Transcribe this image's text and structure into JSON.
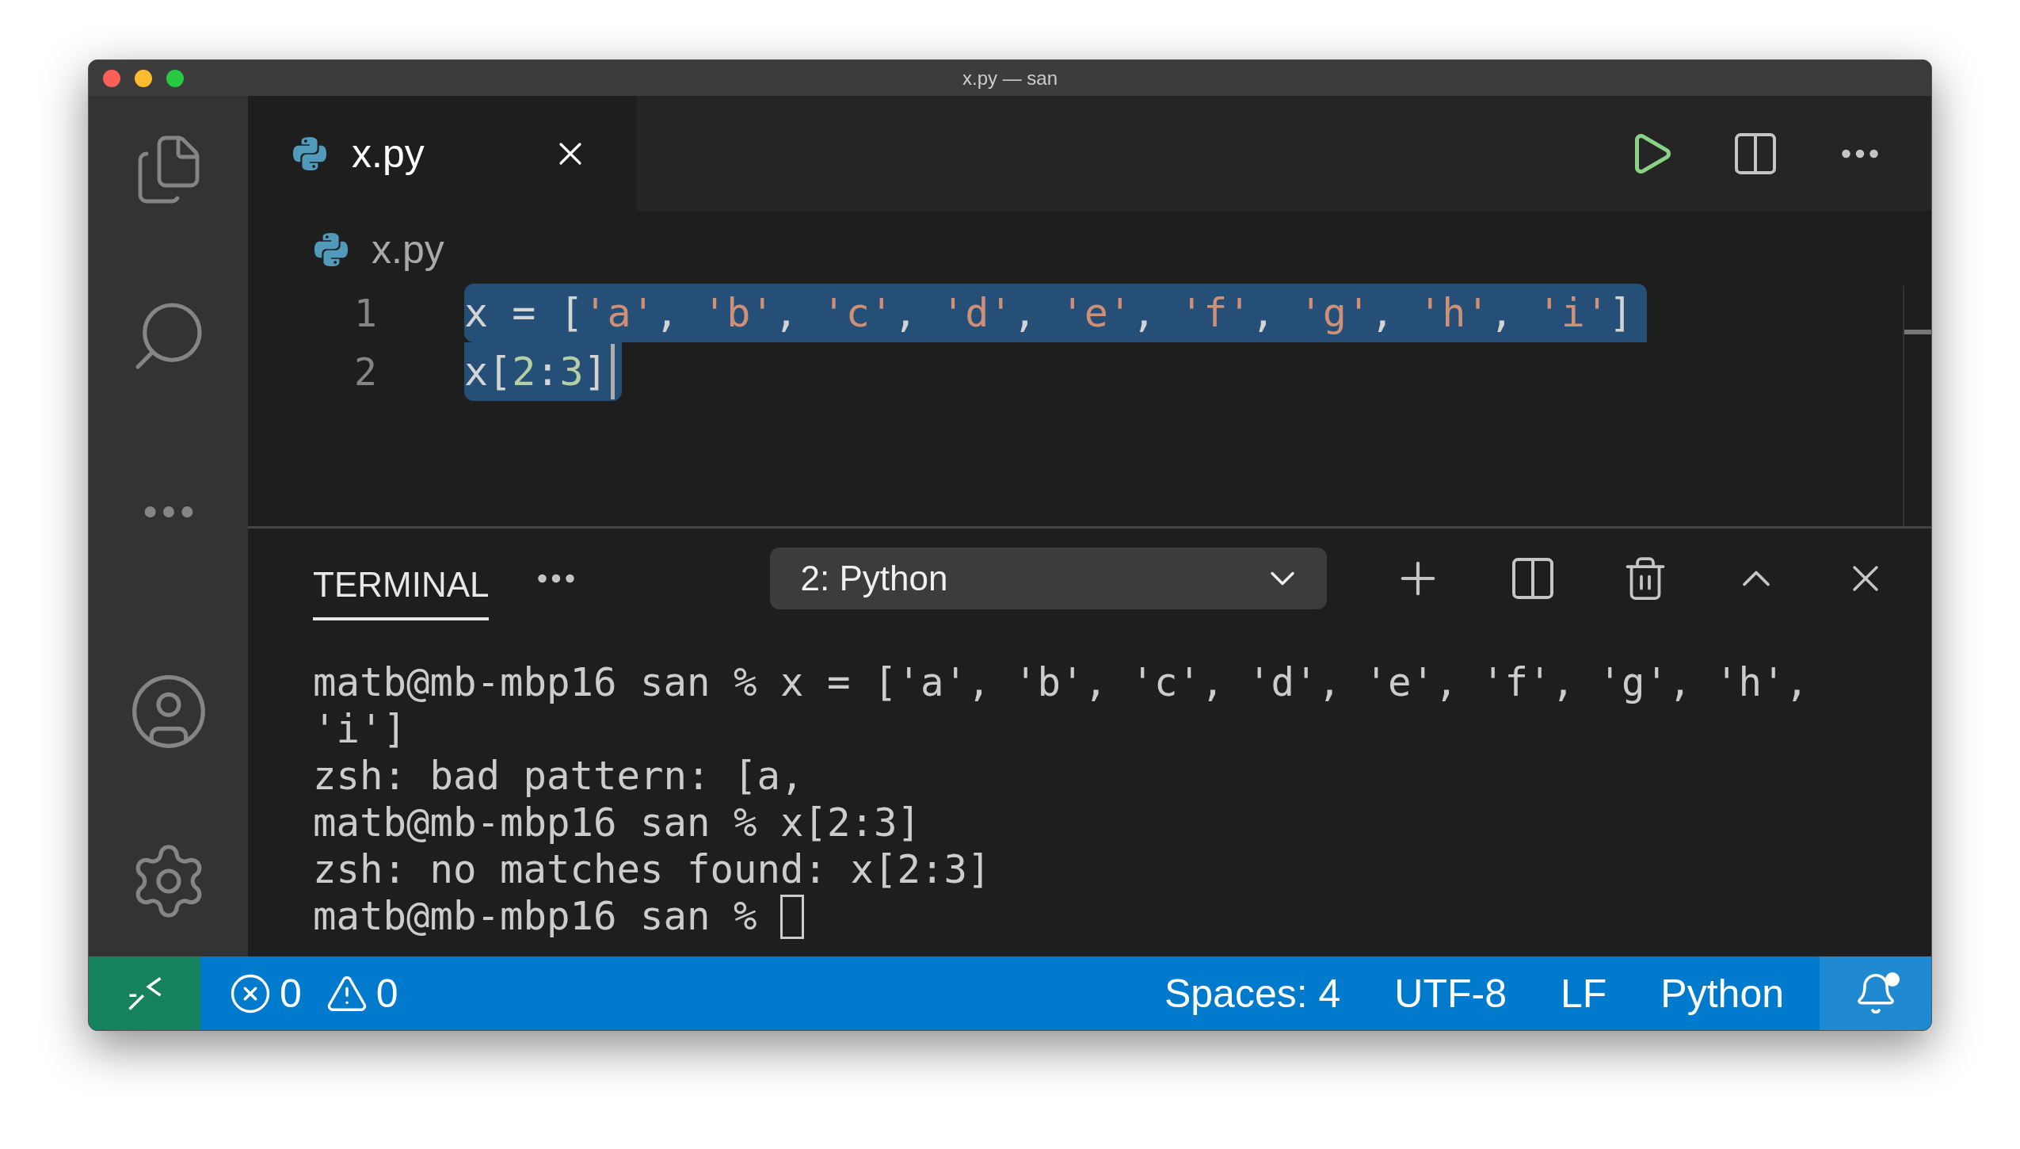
{
  "window": {
    "title": "x.py — san"
  },
  "tabs": [
    {
      "label": "x.py",
      "selected": true
    }
  ],
  "breadcrumb": "x.py",
  "editor": {
    "lines": [
      {
        "number": "1",
        "selected": true,
        "cursor": false,
        "tokens": [
          {
            "kind": "plain",
            "text": "x = ["
          },
          {
            "kind": "string",
            "text": "'a'"
          },
          {
            "kind": "plain",
            "text": ", "
          },
          {
            "kind": "string",
            "text": "'b'"
          },
          {
            "kind": "plain",
            "text": ", "
          },
          {
            "kind": "string",
            "text": "'c'"
          },
          {
            "kind": "plain",
            "text": ", "
          },
          {
            "kind": "string",
            "text": "'d'"
          },
          {
            "kind": "plain",
            "text": ", "
          },
          {
            "kind": "string",
            "text": "'e'"
          },
          {
            "kind": "plain",
            "text": ", "
          },
          {
            "kind": "string",
            "text": "'f'"
          },
          {
            "kind": "plain",
            "text": ", "
          },
          {
            "kind": "string",
            "text": "'g'"
          },
          {
            "kind": "plain",
            "text": ", "
          },
          {
            "kind": "string",
            "text": "'h'"
          },
          {
            "kind": "plain",
            "text": ", "
          },
          {
            "kind": "string",
            "text": "'i'"
          },
          {
            "kind": "plain",
            "text": "]"
          }
        ]
      },
      {
        "number": "2",
        "selected": true,
        "cursor": true,
        "tokens": [
          {
            "kind": "plain",
            "text": "x["
          },
          {
            "kind": "number",
            "text": "2"
          },
          {
            "kind": "plain",
            "text": ":"
          },
          {
            "kind": "number",
            "text": "3"
          },
          {
            "kind": "plain",
            "text": "]"
          }
        ]
      }
    ]
  },
  "panel": {
    "tabs": [
      {
        "label": "TERMINAL",
        "selected": true
      }
    ],
    "terminal_picker": "2: Python",
    "lines": [
      {
        "text": "matb@mb-mbp16 san % x = ['a', 'b', 'c', 'd', 'e', 'f', 'g', 'h',",
        "cursor": false
      },
      {
        "text": "'i']",
        "cursor": false
      },
      {
        "text": "zsh: bad pattern: [a,",
        "cursor": false
      },
      {
        "text": "matb@mb-mbp16 san % x[2:3]",
        "cursor": false
      },
      {
        "text": "zsh: no matches found: x[2:3]",
        "cursor": false
      },
      {
        "text": "matb@mb-mbp16 san % ",
        "cursor": true
      }
    ]
  },
  "status_bar": {
    "errors": "0",
    "warnings": "0",
    "items": [
      "Spaces: 4",
      "UTF-8",
      "LF",
      "Python"
    ],
    "notification": true
  }
}
